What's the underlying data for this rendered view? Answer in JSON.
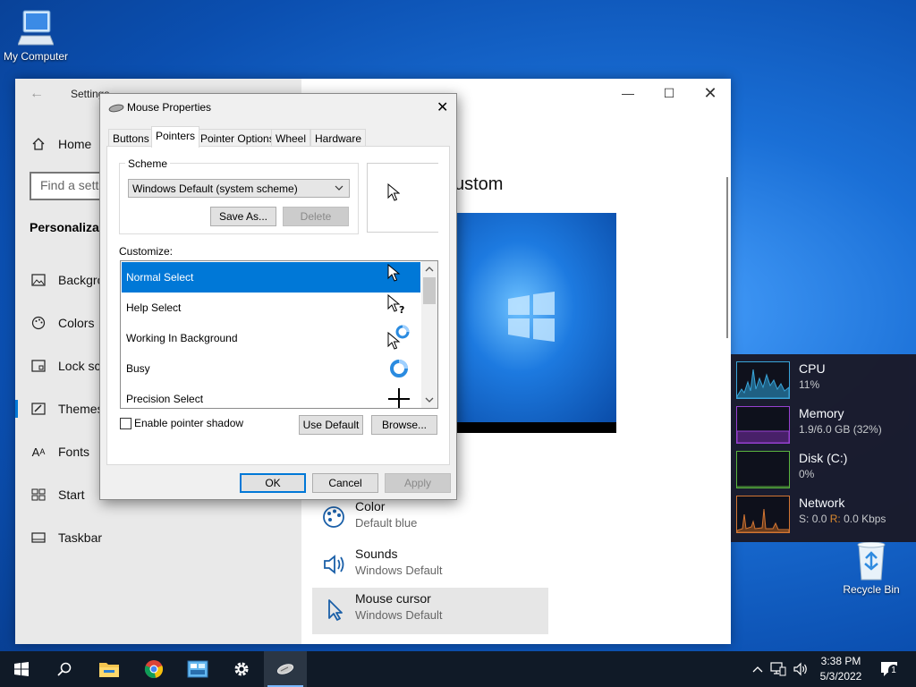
{
  "desktop": {
    "icons": [
      {
        "label": "My Computer"
      },
      {
        "label": "Recycle Bin"
      }
    ]
  },
  "settings": {
    "title": "Settings",
    "nav": {
      "home": "Home",
      "search_placeholder": "Find a setti",
      "section": "Personalizati",
      "items": [
        "Backgro",
        "Colors",
        "Lock scr",
        "Themes",
        "Fonts",
        "Start",
        "Taskbar"
      ]
    },
    "main": {
      "heading_fragment": "ustom",
      "options": [
        {
          "title": "Color",
          "sub": "Default blue",
          "icon": "palette-icon"
        },
        {
          "title": "Sounds",
          "sub": "Windows Default",
          "icon": "speaker-icon"
        },
        {
          "title": "Mouse cursor",
          "sub": "Windows Default",
          "icon": "cursor-icon"
        }
      ]
    }
  },
  "dialog": {
    "title": "Mouse Properties",
    "tabs": [
      "Buttons",
      "Pointers",
      "Pointer Options",
      "Wheel",
      "Hardware"
    ],
    "selected_tab": "Pointers",
    "scheme_label": "Scheme",
    "scheme_value": "Windows Default (system scheme)",
    "save_as": "Save As...",
    "delete": "Delete",
    "customize_label": "Customize:",
    "pointers": [
      {
        "name": "Normal Select",
        "cursor": "arrow"
      },
      {
        "name": "Help Select",
        "cursor": "help"
      },
      {
        "name": "Working In Background",
        "cursor": "working"
      },
      {
        "name": "Busy",
        "cursor": "busy"
      },
      {
        "name": "Precision Select",
        "cursor": "cross"
      }
    ],
    "selected_pointer": "Normal Select",
    "enable_shadow": "Enable pointer shadow",
    "shadow_checked": false,
    "use_default": "Use Default",
    "browse": "Browse...",
    "ok": "OK",
    "cancel": "Cancel",
    "apply": "Apply"
  },
  "sysmon": [
    {
      "name": "CPU",
      "value": "11%",
      "color": "#3aa6d9"
    },
    {
      "name": "Memory",
      "value": "1.9/6.0 GB (32%)",
      "color": "#9b3fd1"
    },
    {
      "name": "Disk (C:)",
      "value": "0%",
      "color": "#5cb83a"
    },
    {
      "name": "Network",
      "send_label": "S:",
      "send_value": "0.0",
      "recv_label": "R:",
      "recv_value": "0.0 Kbps",
      "color": "#d9762e",
      "recv_color": "#e08a2a"
    }
  ],
  "taskbar": {
    "time": "3:38 PM",
    "date": "5/3/2022",
    "notification_count": "1"
  }
}
